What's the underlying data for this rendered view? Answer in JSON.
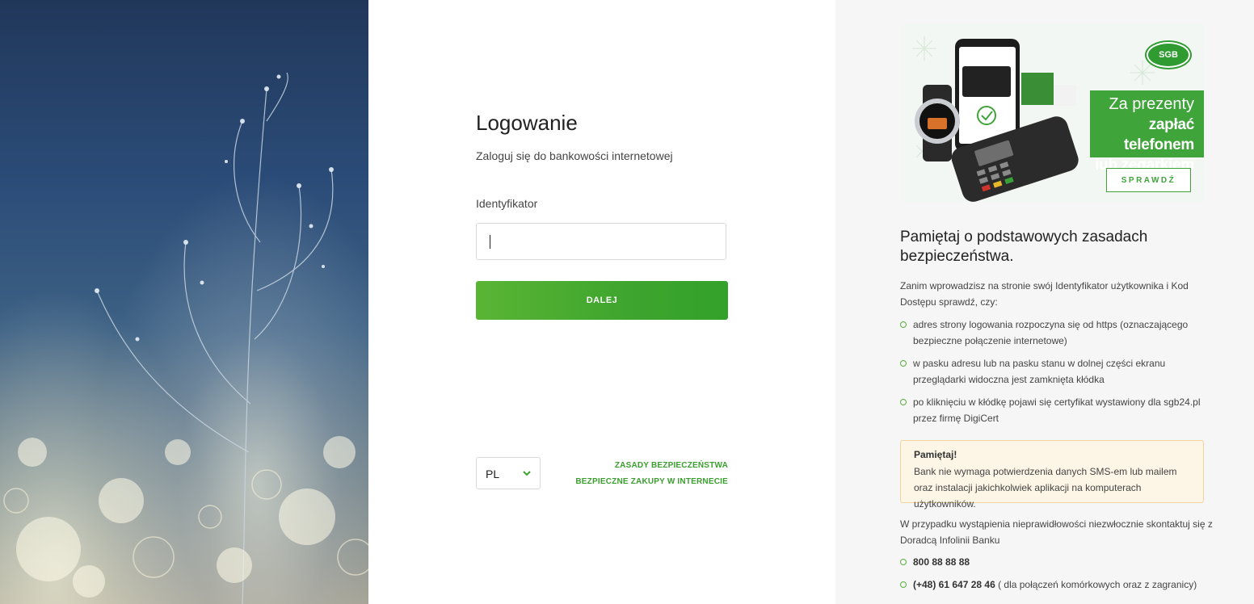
{
  "login": {
    "title": "Logowanie",
    "subtitle": "Zaloguj się do bankowości internetowej",
    "id_label": "Identyfikator",
    "id_value": "",
    "submit_label": "DALEJ",
    "language": "PL",
    "links": {
      "security_rules": "ZASADY BEZPIECZEŃSTWA",
      "safe_shopping": "BEZPIECZNE ZAKUPY W INTERNECIE"
    }
  },
  "banner": {
    "brand": "SGB",
    "line1": "Za prezenty",
    "line2": "zapłać telefonem",
    "line3": "lub zegarkiem",
    "cta": "SPRAWDŹ",
    "accent_color": "#3fa43a"
  },
  "security": {
    "title": "Pamiętaj o podstawowych zasadach bezpieczeństwa.",
    "intro": "Zanim wprowadzisz na stronie swój Identyfikator użytkownika i Kod Dostępu sprawdź, czy:",
    "items": [
      "adres strony logowania rozpoczyna się od https (oznaczającego bezpieczne połączenie internetowe)",
      "w pasku adresu lub na pasku stanu w dolnej części ekranu przeglądarki widoczna jest zamknięta kłódka",
      "po kliknięciu w kłódkę pojawi się certyfikat wystawiony dla sgb24.pl przez firmę DigiCert"
    ],
    "notice_title": "Pamiętaj!",
    "notice_text": "Bank nie wymaga potwierdzenia danych SMS-em lub mailem oraz instalacji jakichkolwiek aplikacji na komputerach użytkowników.",
    "contact_text": "W przypadku wystąpienia nieprawidłowości niezwłocznie skontaktuj się z Doradcą Infolinii Banku",
    "phone1": "800 88 88 88",
    "phone2_number": "(+48) 61 647 28 46",
    "phone2_note": " ( dla połączeń komórkowych oraz z zagranicy)"
  },
  "colors": {
    "primary_green": "#3ea52e",
    "link_green": "#3a9e2e",
    "notice_bg": "#fdf6e7"
  }
}
